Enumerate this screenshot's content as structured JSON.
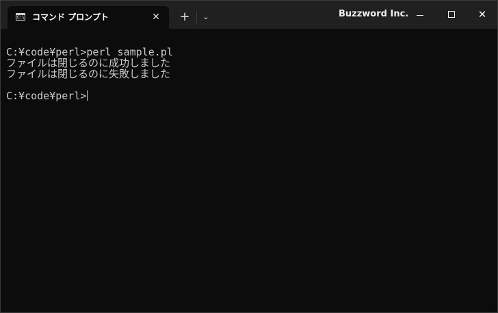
{
  "colors": {
    "titlebar_bg": "#202020",
    "terminal_bg": "#0c0c0c",
    "terminal_fg": "#cccccc",
    "title_fg": "#ffffff"
  },
  "tab": {
    "icon": "command-prompt-icon",
    "icon_glyph": "C:\\",
    "title": "コマンド プロンプト",
    "close_icon": "close-icon"
  },
  "titlebar": {
    "new_tab_label": "+",
    "dropdown_label": "⌄",
    "brand": "Buzzword Inc.",
    "minimize_icon": "minimize-icon",
    "maximize_icon": "maximize-icon",
    "close_label": "✕"
  },
  "terminal": {
    "lines": [
      "",
      "C:¥code¥perl>perl sample.pl",
      "ファイルは閉じるのに成功しました",
      "ファイルは閉じるのに失敗しました",
      "",
      "C:¥code¥perl>"
    ]
  }
}
